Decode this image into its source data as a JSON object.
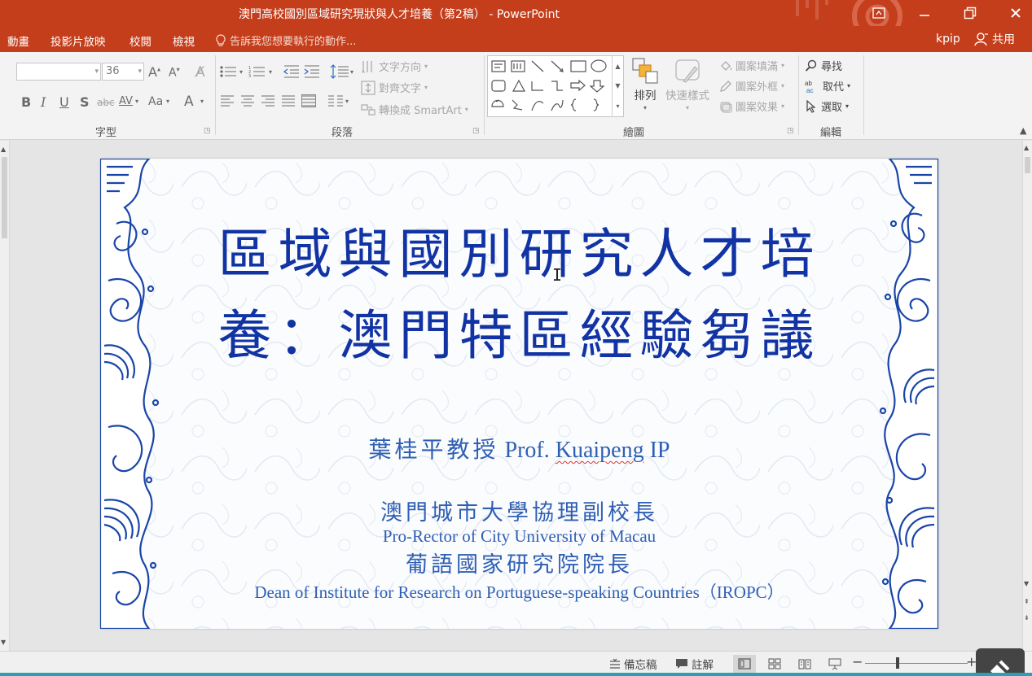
{
  "window": {
    "title": "澳門高校國別區域研究現狀與人才培養（第2稿） - PowerPoint",
    "restore_icon": "restore-window-icon",
    "minimize_icon": "minimize-icon",
    "maximize_icon": "maximize-icon",
    "close_icon": "close-icon"
  },
  "tabs": {
    "items": [
      "動畫",
      "投影片放映",
      "校閱",
      "檢視"
    ],
    "tell_me": "告訴我您想要執行的動作...",
    "user": "kpip",
    "share": "共用"
  },
  "ribbon": {
    "font": {
      "name_value": "",
      "size_value": "36",
      "group_label": "字型",
      "buttons": [
        "B",
        "I",
        "U",
        "S",
        "abc",
        "AV",
        "Aa",
        "A"
      ]
    },
    "paragraph": {
      "text_direction": "文字方向",
      "align_text": "對齊文字",
      "convert_smartart": "轉換成 SmartArt",
      "group_label": "段落"
    },
    "drawing": {
      "arrange": "排列",
      "quick_styles": "快速樣式",
      "shape_fill": "圖案填滿",
      "shape_outline": "圖案外框",
      "shape_effects": "圖案效果",
      "group_label": "繪圖"
    },
    "editing": {
      "find": "尋找",
      "replace": "取代",
      "select": "選取",
      "group_label": "編輯"
    }
  },
  "slide": {
    "title_line1": "區域與國別研究人才培",
    "title_line2": "養：澳門特區經驗芻議",
    "author_cn": "葉桂平教授",
    "author_en_prefix": "Prof.",
    "author_en_name": "Kuaipeng",
    "author_en_suffix": "IP",
    "role1_cn": "澳門城市大學協理副校長",
    "role1_en": "Pro-Rector of City University of Macau",
    "role2_cn": "葡語國家研究院院長",
    "role2_en": "Dean of Institute for Research on Portuguese-speaking Countries（IROPC）"
  },
  "status": {
    "notes": "備忘稿",
    "comments": "註解",
    "zoom_minus": "−",
    "zoom_plus": "+"
  }
}
